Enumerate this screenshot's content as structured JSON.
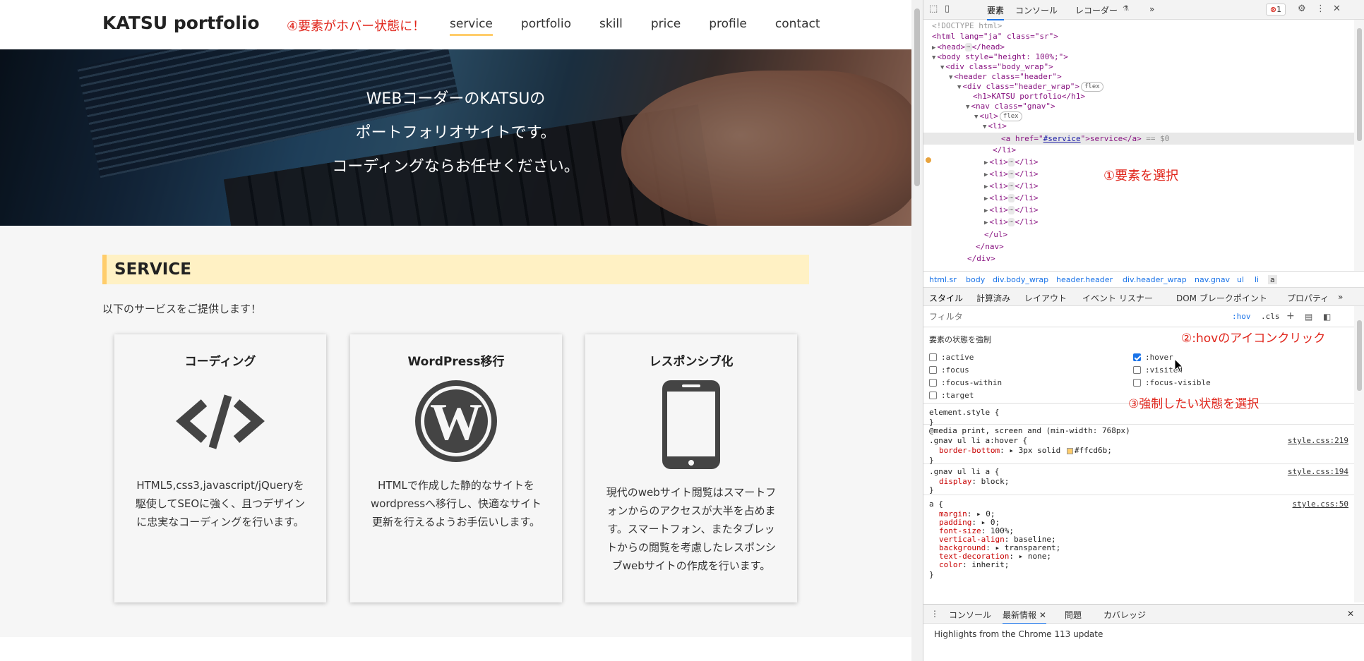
{
  "site": {
    "logo": "KATSU portfolio",
    "annotation_hover": "④要素がホバー状態に！",
    "nav": [
      "service",
      "portfolio",
      "skill",
      "price",
      "profile",
      "contact"
    ],
    "hero_lines": [
      "WEBコーダーのKATSUの",
      "ポートフォリオサイトです。",
      "コーディングならお任せください。"
    ],
    "service_heading": "SERVICE",
    "service_intro": "以下のサービスをご提供します！",
    "cards": [
      {
        "title": "コーディング",
        "icon": "code-icon",
        "desc": "HTML5,css3,javascript/jQueryを駆使してSEOに強く、且つデザインに忠実なコーディングを行います。"
      },
      {
        "title": "WordPress移行",
        "icon": "wordpress-icon",
        "desc": "HTMLで作成した静的なサイトをwordpressへ移行し、快適なサイト更新を行えるようお手伝いします。"
      },
      {
        "title": "レスポンシブ化",
        "icon": "smartphone-icon",
        "desc": "現代のwebサイト閲覧はスマートフォンからのアクセスが大半を占めます。スマートフォン、またタブレットからの閲覧を考慮したレスポンシブwebサイトの作成を行います。"
      }
    ],
    "accent_color": "#ffcd6b",
    "heading_bg": "#fff1c4"
  },
  "devtools": {
    "tabs": [
      "要素",
      "コンソール",
      "レコーダー",
      "»"
    ],
    "error_count": "1",
    "dom": {
      "doctype": "<!DOCTYPE html>",
      "html_open": "<html lang=\"ja\" class=\"sr\">",
      "head": "<head>",
      "head_close": "</head>",
      "body_open": "<body style=\"height: 100%;\">",
      "div_body_wrap": "<div class=\"body_wrap\">",
      "header": "<header class=\"header\">",
      "div_header_wrap": "<div class=\"header_wrap\">",
      "flex": "flex",
      "h1": "<h1>KATSU portfolio</h1>",
      "nav": "<nav class=\"gnav\">",
      "ul": "<ul>",
      "li": "<li>",
      "a_open": "<a href=\"",
      "a_href": "#service",
      "a_rest": "\">service</a>",
      "dollar": " == $0",
      "li_close": "</li>",
      "li_collapsed": "<li>",
      "li_collapsed_close": "</li>",
      "ul_close": "</ul>",
      "nav_close": "</nav>",
      "div_close": "</div>",
      "ellipsis": "⋯"
    },
    "annotation_select": "①要素を選択",
    "breadcrumb": [
      "html.sr",
      "body",
      "div.body_wrap",
      "header.header",
      "div.header_wrap",
      "nav.gnav",
      "ul",
      "li",
      "a"
    ],
    "subtabs": [
      "スタイル",
      "計算済み",
      "レイアウト",
      "イベント リスナー",
      "DOM ブレークポイント",
      "プロパティ",
      "»"
    ],
    "filter_placeholder": "フィルタ",
    "hov_label": ":hov",
    "cls_label": ".cls",
    "force_title": "要素の状態を強制",
    "states_left": [
      ":active",
      ":focus",
      ":focus-within",
      ":target"
    ],
    "states_right": [
      ":hover",
      ":visited",
      ":focus-visible"
    ],
    "hover_checked": true,
    "annotation_hov": "②:hovのアイコンクリック",
    "annotation_state": "③強制したい状態を選択",
    "rules": {
      "element_style": "element.style {",
      "close": "}",
      "media": "@media print, screen and (min-width: 768px)",
      "hover_selector": ".gnav ul li a:hover {",
      "hover_prop": "border-bottom",
      "hover_val_pre": "▸ 3px solid",
      "hover_color": "#ffcd6b",
      "hover_src": "style.css:219",
      "a_selector": ".gnav ul li a {",
      "a_prop": "display",
      "a_val": "block;",
      "a_src": "style.css:194",
      "base_selector": "a {",
      "base_src": "style.css:50",
      "base_props": [
        {
          "name": "margin",
          "value": "▸ 0;"
        },
        {
          "name": "padding",
          "value": "▸ 0;"
        },
        {
          "name": "font-size",
          "value": "100%;"
        },
        {
          "name": "vertical-align",
          "value": "baseline;"
        },
        {
          "name": "background",
          "value": "▸ transparent;"
        },
        {
          "name": "text-decoration",
          "value": "▸ none;"
        },
        {
          "name": "color",
          "value": "inherit;"
        }
      ]
    },
    "drawer_tabs": [
      "コンソール",
      "最新情報",
      "問題",
      "カバレッジ"
    ],
    "highlights": "Highlights from the Chrome 113 update"
  }
}
